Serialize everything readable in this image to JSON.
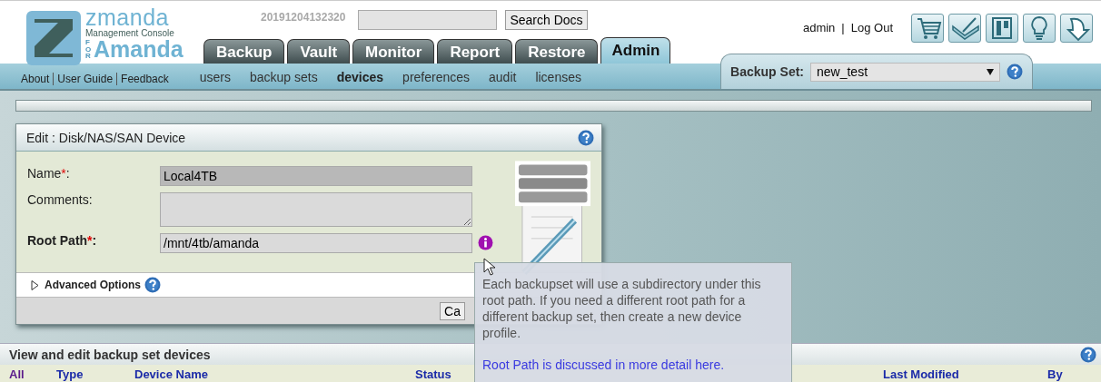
{
  "header": {
    "logo": {
      "name": "zmanda",
      "subtitle": "Management Console",
      "for_mark": "FOR",
      "product": "Amanda"
    },
    "build": "20191204132320",
    "search_button": "Search Docs",
    "user": "admin",
    "separator": "|",
    "logout": "Log Out"
  },
  "tabs": [
    {
      "label": "Backup",
      "selected": false
    },
    {
      "label": "Vault",
      "selected": false
    },
    {
      "label": "Monitor",
      "selected": false
    },
    {
      "label": "Report",
      "selected": false
    },
    {
      "label": "Restore",
      "selected": false
    },
    {
      "label": "Admin",
      "selected": true
    }
  ],
  "help_links": [
    "About",
    "User Guide",
    "Feedback"
  ],
  "subnav": [
    {
      "label": "users",
      "selected": false
    },
    {
      "label": "backup sets",
      "selected": false
    },
    {
      "label": "devices",
      "selected": true
    },
    {
      "label": "preferences",
      "selected": false
    },
    {
      "label": "audit",
      "selected": false
    },
    {
      "label": "licenses",
      "selected": false
    }
  ],
  "backup_set": {
    "label": "Backup Set:",
    "value": "new_test"
  },
  "edit_panel": {
    "title": "Edit : Disk/NAS/SAN Device",
    "fields": [
      {
        "kind": "input",
        "label": "Name",
        "asterisk": "*",
        "label_end": ":",
        "value": "Local4TB",
        "disabled": true,
        "bold": false,
        "info": false
      },
      {
        "kind": "textarea",
        "label": "Comments:",
        "disabled": false,
        "bold": false,
        "info": false
      },
      {
        "kind": "input",
        "label": "Root Path",
        "asterisk": "*",
        "label_end": ":",
        "value": "/mnt/4tb/amanda",
        "disabled": false,
        "bold": true,
        "info": true
      }
    ],
    "advanced": {
      "label": "Advanced Options",
      "expanded": false
    },
    "buttons": [
      "Ca"
    ]
  },
  "tooltip": {
    "text": "Each backupset will use a subdirectory under this root path. If you need a different root path for a different backup set, then create a new device profile.",
    "link": "Root Path is discussed in more detail here."
  },
  "devices_panel": {
    "title": "View and edit backup set devices",
    "columns": [
      "All",
      "Type",
      "Device Name",
      "Status",
      "Last Modified",
      "By"
    ]
  }
}
